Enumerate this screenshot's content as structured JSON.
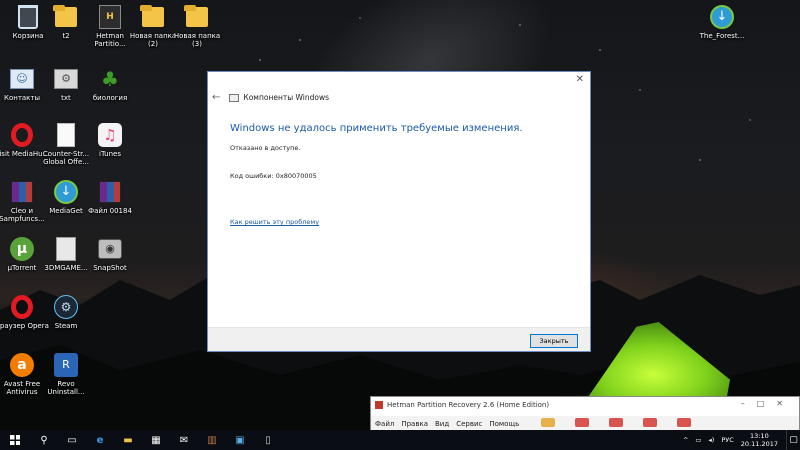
{
  "desktop": {
    "icons": [
      {
        "label": "Корзина",
        "icon": "recycle-bin-icon"
      },
      {
        "label": "t2",
        "icon": "folder-icon"
      },
      {
        "label": "Hetman Partitio...",
        "icon": "hetman-partition-icon"
      },
      {
        "label": "Новая папка (2)",
        "icon": "folder-icon"
      },
      {
        "label": "Новая папка (3)",
        "icon": "folder-icon"
      },
      {
        "label": "Контакты",
        "icon": "contacts-icon"
      },
      {
        "label": "txt",
        "icon": "text-file-icon"
      },
      {
        "label": "биология",
        "icon": "tree-icon"
      },
      {
        "label": "Visit MediaHu...",
        "icon": "opera-icon"
      },
      {
        "label": "Counter-Str... Global Offe...",
        "icon": "document-icon"
      },
      {
        "label": "iTunes",
        "icon": "itunes-icon"
      },
      {
        "label": "Cleo и Sampfuncs...",
        "icon": "winrar-icon"
      },
      {
        "label": "MediaGet",
        "icon": "mediaget-icon"
      },
      {
        "label": "Файл 00184",
        "icon": "winrar-icon"
      },
      {
        "label": "µTorrent",
        "icon": "utorrent-icon"
      },
      {
        "label": "3DMGAME...",
        "icon": "document-icon"
      },
      {
        "label": "SnapShot",
        "icon": "camera-icon"
      },
      {
        "label": "Браузер Opera",
        "icon": "opera-icon"
      },
      {
        "label": "Steam",
        "icon": "steam-icon"
      },
      {
        "label": "Avast Free Antivirus",
        "icon": "avast-icon"
      },
      {
        "label": "Revo Uninstall...",
        "icon": "revo-uninstaller-icon"
      },
      {
        "label": "The_Forest...",
        "icon": "mediaget-icon"
      }
    ]
  },
  "dialog": {
    "header_title": "Компоненты Windows",
    "error_title": "Windows не удалось применить требуемые изменения.",
    "message": "Отказано в доступе.",
    "error_code": "Код ошибки: 0x80070005",
    "help_link": "Как решить эту проблему",
    "close_button": "Закрыть",
    "close_glyph": "✕",
    "back_glyph": "←"
  },
  "hetman_window": {
    "title": "Hetman Partition Recovery 2.6 (Home Edition)",
    "menu": [
      "Файл",
      "Правка",
      "Вид",
      "Сервис",
      "Помощь"
    ],
    "controls": "–□✕"
  },
  "taskbar": {
    "language": "РУС",
    "time": "13:10",
    "date": "20.11.2017",
    "accent_color": "#0078d7"
  }
}
